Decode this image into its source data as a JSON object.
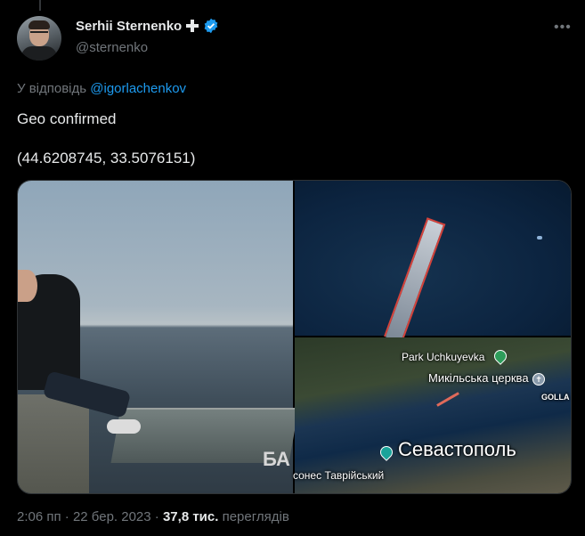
{
  "author": {
    "display_name": "Serhii Sternenko",
    "handle": "@sternenko",
    "verified": true,
    "badge_icon": "cross-icon"
  },
  "reply": {
    "prefix": "У відповідь",
    "to": "@igorlachenkov"
  },
  "tweet": {
    "line1": "Geo confirmed",
    "line2": "(44.6208745, 33.5076151)"
  },
  "media": {
    "watermark": "БА",
    "map": {
      "park_label": "Park Uchkuyevka",
      "church_label": "Микільська церква",
      "golla_label": "GOLLA",
      "city_label": "Севастополь",
      "district_label": "сонес Таврійський"
    }
  },
  "meta": {
    "time": "2:06 пп",
    "separator": " · ",
    "date": "22 бер. 2023",
    "views_count": "37,8 тис.",
    "views_label": "переглядів"
  },
  "colors": {
    "accent": "#1d9bf0",
    "muted": "#71767b",
    "text": "#e7e9ea",
    "background": "#000000"
  }
}
